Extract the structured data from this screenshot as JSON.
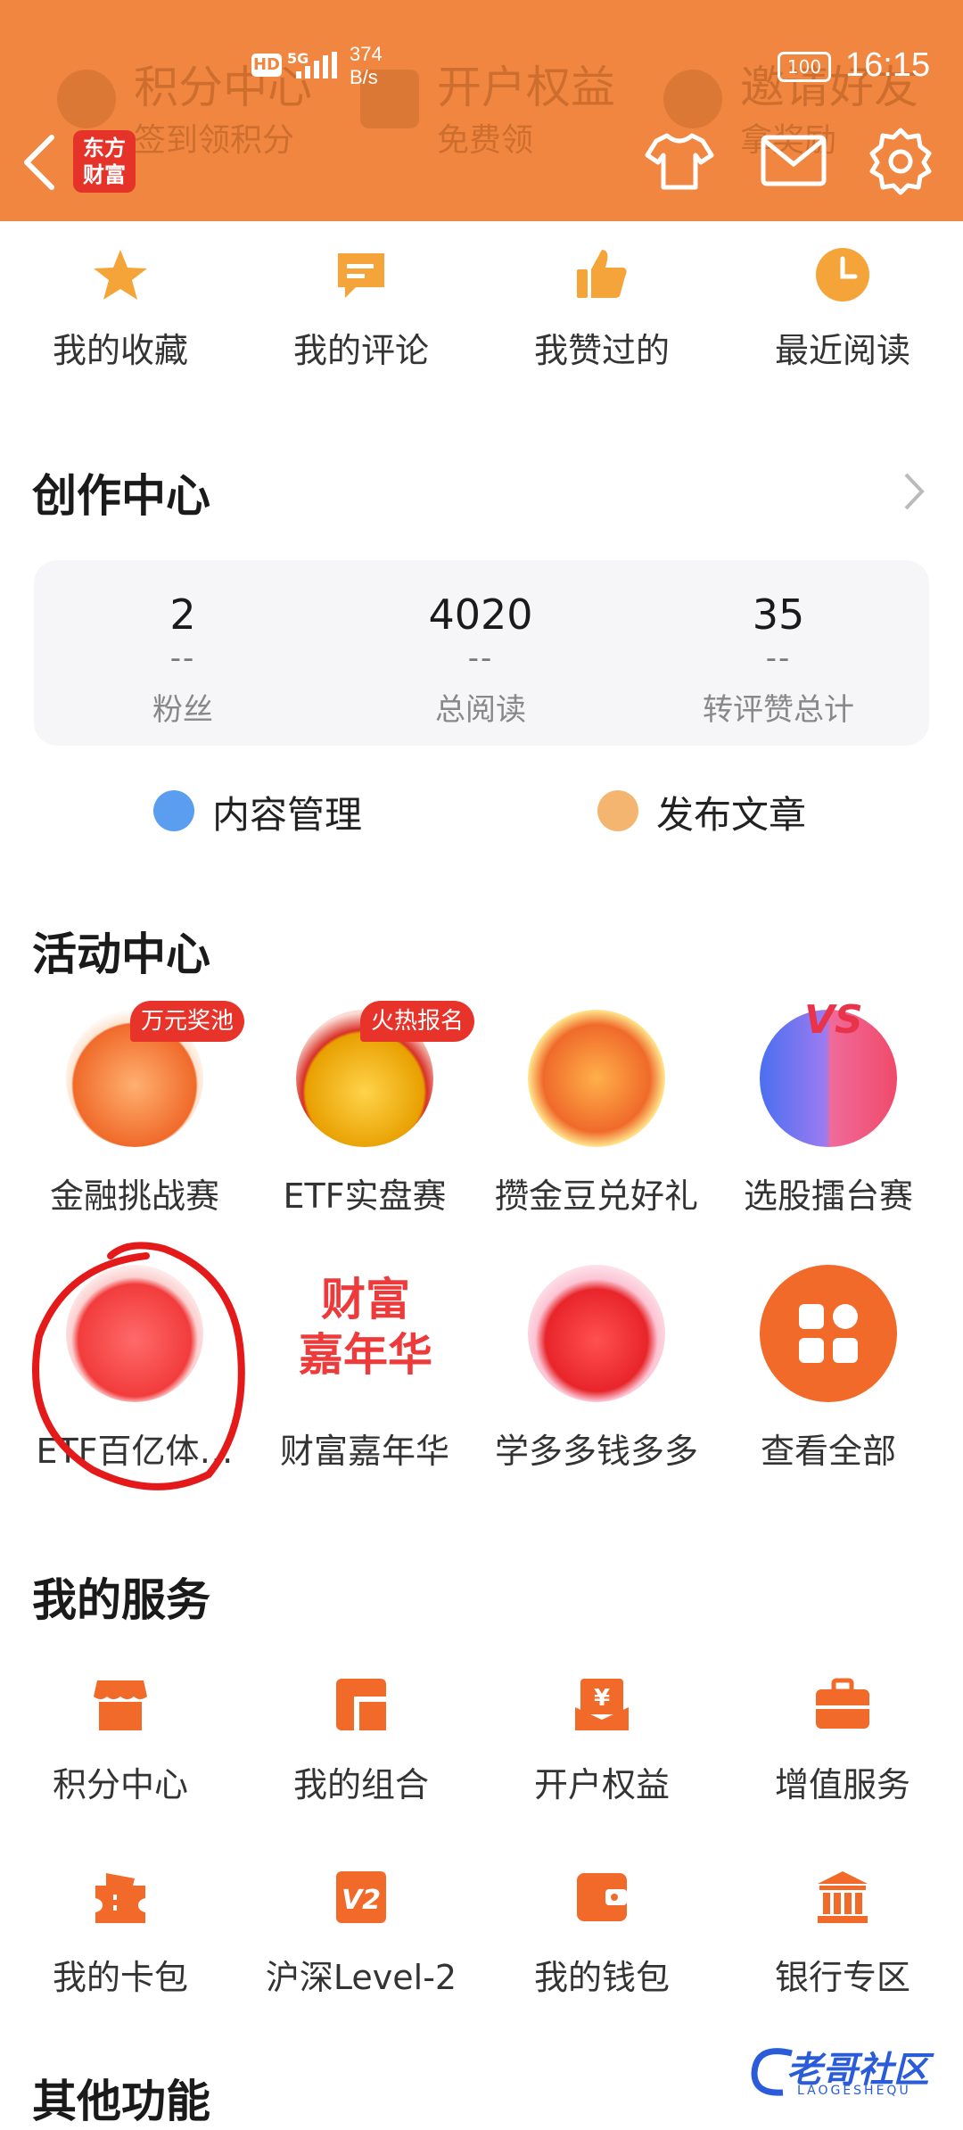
{
  "header": {
    "bg_labels": [
      {
        "title": "积分中心",
        "sub": "签到领积分"
      },
      {
        "title": "开户权益",
        "sub": "免费领"
      },
      {
        "title": "邀请好友",
        "sub": "拿奖励"
      }
    ],
    "logo_text": "东方财富",
    "accent": "#f08640"
  },
  "status_bar": {
    "network": "HD",
    "signal": "5G",
    "speed_value": "374",
    "speed_unit": "B/s",
    "battery": "100",
    "time": "16:15"
  },
  "quick_links": [
    {
      "label": "我的收藏",
      "icon": "star-icon"
    },
    {
      "label": "我的评论",
      "icon": "comment-icon"
    },
    {
      "label": "我赞过的",
      "icon": "thumbs-up-icon"
    },
    {
      "label": "最近阅读",
      "icon": "clock-icon"
    }
  ],
  "creation": {
    "title": "创作中心",
    "stats": [
      {
        "value": "2",
        "delta": "--",
        "label": "粉丝"
      },
      {
        "value": "4020",
        "delta": "--",
        "label": "总阅读"
      },
      {
        "value": "35",
        "delta": "--",
        "label": "转评赞总计"
      }
    ],
    "actions": [
      {
        "label": "内容管理",
        "color": "#5b9ef0"
      },
      {
        "label": "发布文章",
        "color": "#f3b570"
      }
    ]
  },
  "activities": {
    "title": "活动中心",
    "items": [
      {
        "label": "金融挑战赛",
        "badge": "万元奖池"
      },
      {
        "label": "ETF实盘赛",
        "badge": "火热报名"
      },
      {
        "label": "攒金豆兑好礼",
        "badge": ""
      },
      {
        "label": "选股擂台赛",
        "badge": ""
      },
      {
        "label": "ETF百亿体…",
        "badge": ""
      },
      {
        "label": "财富嘉年华",
        "badge": "",
        "art_text_1": "财富",
        "art_text_2": "嘉年华"
      },
      {
        "label": "学多多钱多多",
        "badge": ""
      },
      {
        "label": "查看全部",
        "badge": ""
      }
    ],
    "vs_text": "VS"
  },
  "services": {
    "title": "我的服务",
    "items": [
      {
        "label": "积分中心",
        "icon": "store-icon"
      },
      {
        "label": "我的组合",
        "icon": "portfolio-icon"
      },
      {
        "label": "开户权益",
        "icon": "yen-gift-icon"
      },
      {
        "label": "增值服务",
        "icon": "briefcase-icon"
      },
      {
        "label": "我的卡包",
        "icon": "ticket-icon"
      },
      {
        "label": "沪深Level-2",
        "icon": "level2-icon",
        "glyph": "V2"
      },
      {
        "label": "我的钱包",
        "icon": "wallet-icon"
      },
      {
        "label": "银行专区",
        "icon": "bank-icon"
      }
    ],
    "yen_glyph": "¥"
  },
  "other": {
    "title": "其他功能"
  },
  "watermark": {
    "text": "老哥社区",
    "sub": "LAOGESHEQU"
  }
}
